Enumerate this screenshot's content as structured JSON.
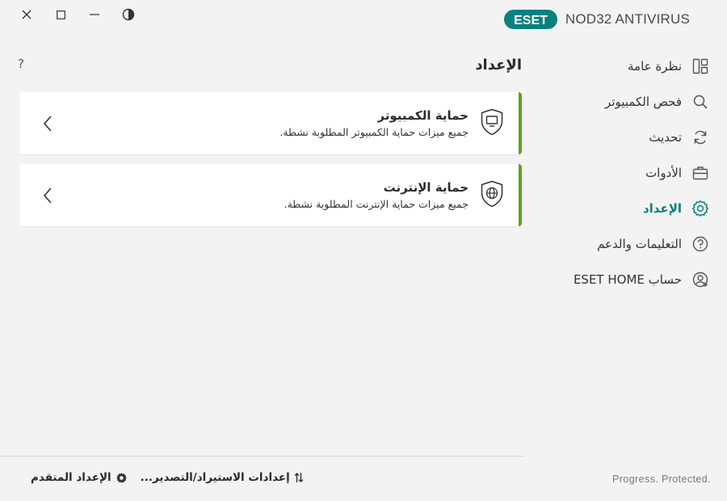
{
  "window": {
    "controls": [
      "close-icon",
      "maximize-icon",
      "minimize-icon",
      "contrast-icon"
    ]
  },
  "brand": {
    "logo_text": "ESET",
    "product": "NOD32 ANTIVIRUS",
    "accent_color": "#0a8080"
  },
  "sidebar": {
    "items": [
      {
        "label": "نظرة عامة",
        "icon": "overview-icon",
        "active": false
      },
      {
        "label": "فحص الكمبيوتر",
        "icon": "search-icon",
        "active": false
      },
      {
        "label": "تحديث",
        "icon": "refresh-icon",
        "active": false
      },
      {
        "label": "الأدوات",
        "icon": "toolbox-icon",
        "active": false
      },
      {
        "label": "الإعداد",
        "icon": "gear-icon",
        "active": true
      },
      {
        "label": "التعليمات والدعم",
        "icon": "help-icon",
        "active": false
      },
      {
        "label": "حساب ESET HOME",
        "icon": "account-icon",
        "active": false
      }
    ]
  },
  "main": {
    "title": "الإعداد",
    "help": "?",
    "cards": [
      {
        "title": "حماية الكمبيوتر",
        "desc": "جميع ميزات حماية الكمبيوتر المطلوبة نشطة.",
        "icon": "computer-shield-icon",
        "status_color": "#5ea321"
      },
      {
        "title": "حماية الإنترنت",
        "desc": "جميع ميزات حماية الإنترنت المطلوبة نشطة.",
        "icon": "globe-shield-icon",
        "status_color": "#5ea321"
      }
    ]
  },
  "footer": {
    "advanced": "الإعداد المتقدم",
    "import_export": "إعدادات الاستيراد/التصدير...",
    "tagline": "Progress. Protected."
  }
}
